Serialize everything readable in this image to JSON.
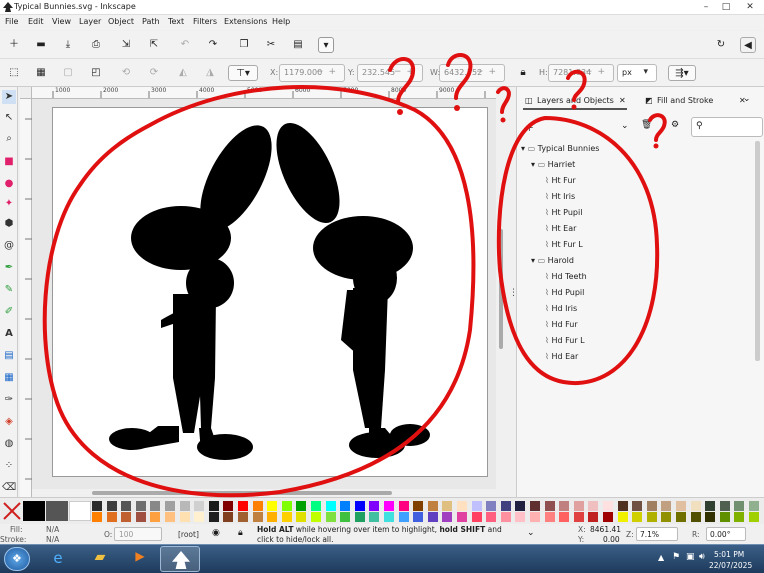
{
  "window": {
    "title": "Typical Bunnies.svg - Inkscape"
  },
  "menu": [
    "File",
    "Edit",
    "View",
    "Layer",
    "Object",
    "Path",
    "Text",
    "Filters",
    "Extensions",
    "Help"
  ],
  "selection": {
    "x_label": "X:",
    "x_value": "1179.000",
    "y_label": "Y:",
    "y_value": "232.545",
    "w_label": "W:",
    "w_value": "6432.752",
    "h_label": "H:",
    "h_value": "7281.834",
    "unit": "px"
  },
  "ruler": {
    "h_ticks": [
      "1000",
      "2000",
      "3000",
      "4000",
      "5000",
      "6000",
      "7000",
      "8000",
      "9000"
    ]
  },
  "dialog": {
    "tabs": [
      "Layers and Objects",
      "Fill and Stroke"
    ],
    "tree": [
      {
        "label": "Typical Bunnies",
        "level": 0,
        "type": "folder"
      },
      {
        "label": "Harriet",
        "level": 1,
        "type": "folder"
      },
      {
        "label": "Ht Fur",
        "level": 2,
        "type": "path"
      },
      {
        "label": "Ht Iris",
        "level": 2,
        "type": "path"
      },
      {
        "label": "Ht Pupil",
        "level": 2,
        "type": "path"
      },
      {
        "label": "Ht Ear",
        "level": 2,
        "type": "path"
      },
      {
        "label": "Ht Fur L",
        "level": 2,
        "type": "path"
      },
      {
        "label": "Harold",
        "level": 1,
        "type": "folder"
      },
      {
        "label": "Hd Teeth",
        "level": 2,
        "type": "path"
      },
      {
        "label": "Hd Pupil",
        "level": 2,
        "type": "path"
      },
      {
        "label": "Hd Iris",
        "level": 2,
        "type": "path"
      },
      {
        "label": "Hd Fur",
        "level": 2,
        "type": "path"
      },
      {
        "label": "Hd Fur L",
        "level": 2,
        "type": "path"
      },
      {
        "label": "Hd Ear",
        "level": 2,
        "type": "path"
      }
    ]
  },
  "status": {
    "fill_label": "Fill:",
    "fill_value": "N/A",
    "stroke_label": "Stroke:",
    "stroke_value": "N/A",
    "opacity_label": "O:",
    "opacity_value": "100",
    "layer": "[root]",
    "message_bold1": "Hold ALT",
    "message_part1": " while hovering over item to highlight, ",
    "message_bold2": "hold SHIFT",
    "message_part2": " and click to hide/lock all.",
    "cursor_x_label": "X:",
    "cursor_x": "8461.41",
    "cursor_y_label": "Y:",
    "cursor_y": "0.00",
    "zoom_label": "Z:",
    "zoom": "7.1%",
    "rotation_label": "R:",
    "rotation": "0.00°"
  },
  "taskbar": {
    "time": "5:01 PM",
    "date": "22/07/2025"
  },
  "colors": {
    "annotation": "#e01010",
    "accent": "#3a6ea5"
  }
}
